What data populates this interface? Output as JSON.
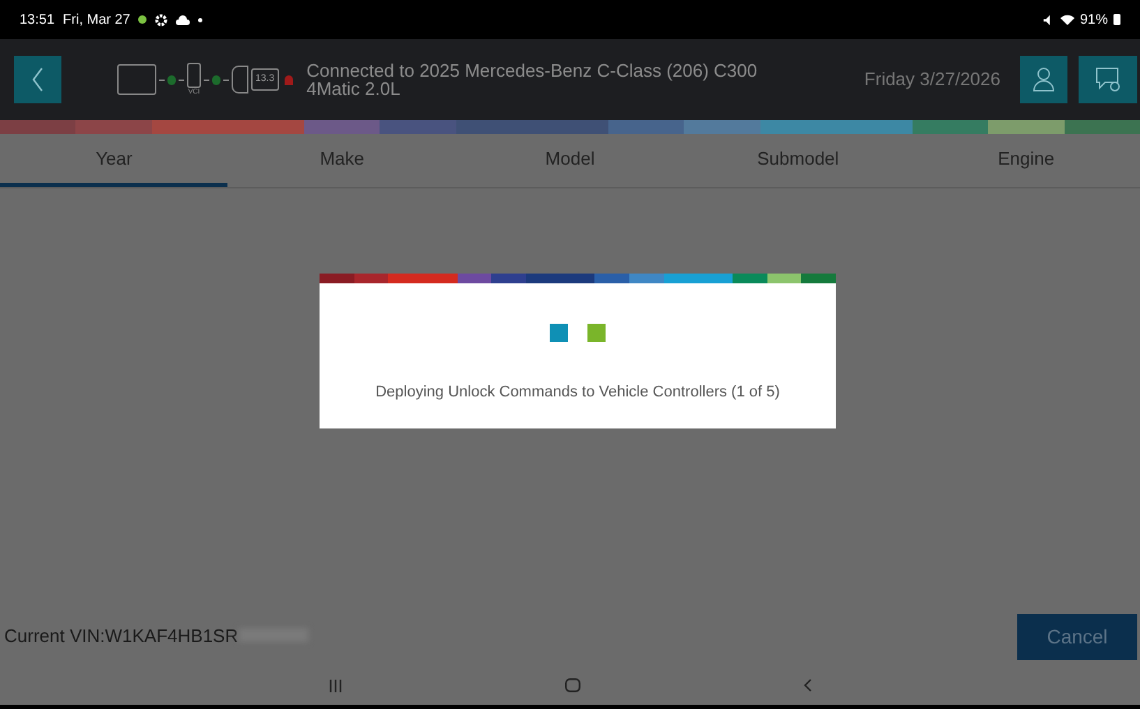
{
  "status_bar": {
    "time": "13:51",
    "date": "Fri, Mar 27",
    "battery": "91%"
  },
  "header": {
    "diagnostic_chain": {
      "vci_label": "VCI",
      "voltage": "13.3"
    },
    "connection": "Connected to 2025 Mercedes-Benz C-Class (206) C300 4Matic 2.0L",
    "date": "Friday 3/27/2026"
  },
  "tabs": [
    {
      "label": "Year",
      "selected": true
    },
    {
      "label": "Make",
      "selected": false
    },
    {
      "label": "Model",
      "selected": false
    },
    {
      "label": "Submodel",
      "selected": false
    },
    {
      "label": "Engine",
      "selected": false
    }
  ],
  "dialog": {
    "message": "Deploying Unlock Commands to Vehicle Controllers (1 of 5)"
  },
  "footer": {
    "vin": "Current VIN:W1KAF4HB1SR",
    "cancel": "Cancel"
  }
}
